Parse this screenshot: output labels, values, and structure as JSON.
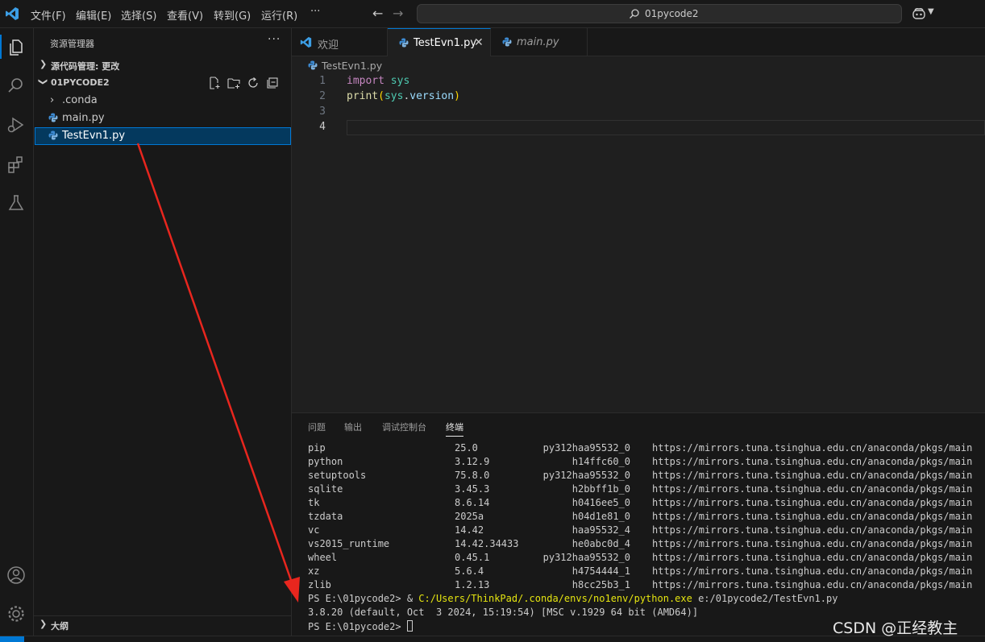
{
  "menu": {
    "items": [
      "文件(F)",
      "编辑(E)",
      "选择(S)",
      "查看(V)",
      "转到(G)",
      "运行(R)"
    ],
    "more": "···"
  },
  "command_center": {
    "text": "01pycode2",
    "icon": "search-icon"
  },
  "activity_bar": {
    "icons": [
      "files-icon",
      "search-icon",
      "run-debug-icon",
      "extensions-icon",
      "testing-flask-icon",
      "account-icon",
      "gear-icon"
    ]
  },
  "sidebar": {
    "title": "资源管理器",
    "more": "···",
    "source_control": "源代码管理: 更改",
    "folder": "01PYCODE2",
    "tree": [
      ".conda",
      "main.py",
      "TestEvn1.py"
    ],
    "outline": "大纲"
  },
  "tabs": [
    {
      "label": "欢迎",
      "icon": "vscode-logo-icon"
    },
    {
      "label": "TestEvn1.py",
      "icon": "python-icon",
      "close": "✕"
    },
    {
      "label": "main.py",
      "icon": "python-icon"
    }
  ],
  "breadcrumb": "TestEvn1.py",
  "code": {
    "line_numbers": [
      "1",
      "2",
      "3",
      "4"
    ],
    "line1": {
      "kw": "import",
      "mod": "sys"
    },
    "line2": {
      "fn": "print",
      "open": "(",
      "obj": "sys",
      "dot": ".",
      "attr": "version",
      "close": ")"
    }
  },
  "panel": {
    "tabs": [
      "问题",
      "输出",
      "调试控制台",
      "终端"
    ],
    "active_tab": "终端"
  },
  "terminal": {
    "packages": [
      {
        "name": "pip",
        "version": "25.0",
        "build": "py312haa95532_0",
        "channel": "https://mirrors.tuna.tsinghua.edu.cn/anaconda/pkgs/main"
      },
      {
        "name": "python",
        "version": "3.12.9",
        "build": "h14ffc60_0",
        "channel": "https://mirrors.tuna.tsinghua.edu.cn/anaconda/pkgs/main"
      },
      {
        "name": "setuptools",
        "version": "75.8.0",
        "build": "py312haa95532_0",
        "channel": "https://mirrors.tuna.tsinghua.edu.cn/anaconda/pkgs/main"
      },
      {
        "name": "sqlite",
        "version": "3.45.3",
        "build": "h2bbff1b_0",
        "channel": "https://mirrors.tuna.tsinghua.edu.cn/anaconda/pkgs/main"
      },
      {
        "name": "tk",
        "version": "8.6.14",
        "build": "h0416ee5_0",
        "channel": "https://mirrors.tuna.tsinghua.edu.cn/anaconda/pkgs/main"
      },
      {
        "name": "tzdata",
        "version": "2025a",
        "build": "h04d1e81_0",
        "channel": "https://mirrors.tuna.tsinghua.edu.cn/anaconda/pkgs/main"
      },
      {
        "name": "vc",
        "version": "14.42",
        "build": "haa95532_4",
        "channel": "https://mirrors.tuna.tsinghua.edu.cn/anaconda/pkgs/main"
      },
      {
        "name": "vs2015_runtime",
        "version": "14.42.34433",
        "build": "he0abc0d_4",
        "channel": "https://mirrors.tuna.tsinghua.edu.cn/anaconda/pkgs/main"
      },
      {
        "name": "wheel",
        "version": "0.45.1",
        "build": "py312haa95532_0",
        "channel": "https://mirrors.tuna.tsinghua.edu.cn/anaconda/pkgs/main"
      },
      {
        "name": "xz",
        "version": "5.6.4",
        "build": "h4754444_1",
        "channel": "https://mirrors.tuna.tsinghua.edu.cn/anaconda/pkgs/main"
      },
      {
        "name": "zlib",
        "version": "1.2.13",
        "build": "h8cc25b3_1",
        "channel": "https://mirrors.tuna.tsinghua.edu.cn/anaconda/pkgs/main"
      }
    ],
    "run_prompt": "PS E:\\01pycode2> ",
    "run_amp": "& ",
    "run_exe": "C:/Users/ThinkPad/.conda/envs/no1env/python.exe",
    "run_arg": " e:/01pycode2/TestEvn1.py",
    "output": "3.8.20 (default, Oct  3 2024, 15:19:54) [MSC v.1929 64 bit (AMD64)]",
    "final_prompt": "PS E:\\01pycode2> "
  },
  "watermark": "CSDN @正经教主",
  "colors": {
    "accent": "#0078d4",
    "annotation_arrow": "#e8261e",
    "exe_path": "#e5e510"
  }
}
